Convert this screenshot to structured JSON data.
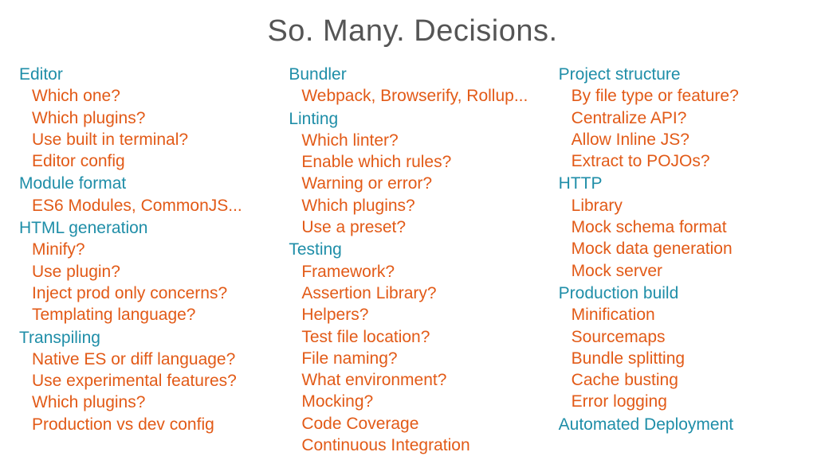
{
  "title": "So. Many. Decisions.",
  "colors": {
    "heading": "#1f8ea8",
    "item": "#e25a17",
    "title": "#555555"
  },
  "columns": [
    {
      "sections": [
        {
          "heading": "Editor",
          "items": [
            "Which one?",
            "Which plugins?",
            "Use built in terminal?",
            "Editor config"
          ]
        },
        {
          "heading": "Module format",
          "items": [
            "ES6 Modules, CommonJS..."
          ]
        },
        {
          "heading": "HTML generation",
          "items": [
            "Minify?",
            "Use plugin?",
            "Inject prod only concerns?",
            "Templating language?"
          ]
        },
        {
          "heading": "Transpiling",
          "items": [
            "Native ES or diff language?",
            "Use experimental features?",
            "Which plugins?",
            "Production vs dev config"
          ]
        }
      ]
    },
    {
      "sections": [
        {
          "heading": "Bundler",
          "items": [
            "Webpack, Browserify, Rollup..."
          ]
        },
        {
          "heading": "Linting",
          "items": [
            "Which linter?",
            "Enable which rules?",
            "Warning or error?",
            "Which plugins?",
            "Use a preset?"
          ]
        },
        {
          "heading": "Testing",
          "items": [
            "Framework?",
            "Assertion Library?",
            "Helpers?",
            "Test file location?",
            "File naming?",
            "What environment?",
            "Mocking?",
            "Code Coverage",
            "Continuous Integration"
          ]
        }
      ]
    },
    {
      "sections": [
        {
          "heading": "Project structure",
          "items": [
            "By file type or feature?",
            "Centralize API?",
            "Allow Inline JS?",
            "Extract to POJOs?"
          ]
        },
        {
          "heading": "HTTP",
          "items": [
            "Library",
            "Mock schema format",
            "Mock data generation",
            "Mock server"
          ]
        },
        {
          "heading": "Production build",
          "items": [
            "Minification",
            "Sourcemaps",
            "Bundle splitting",
            "Cache busting",
            "Error logging"
          ]
        },
        {
          "heading": "Automated Deployment",
          "items": []
        }
      ]
    }
  ]
}
